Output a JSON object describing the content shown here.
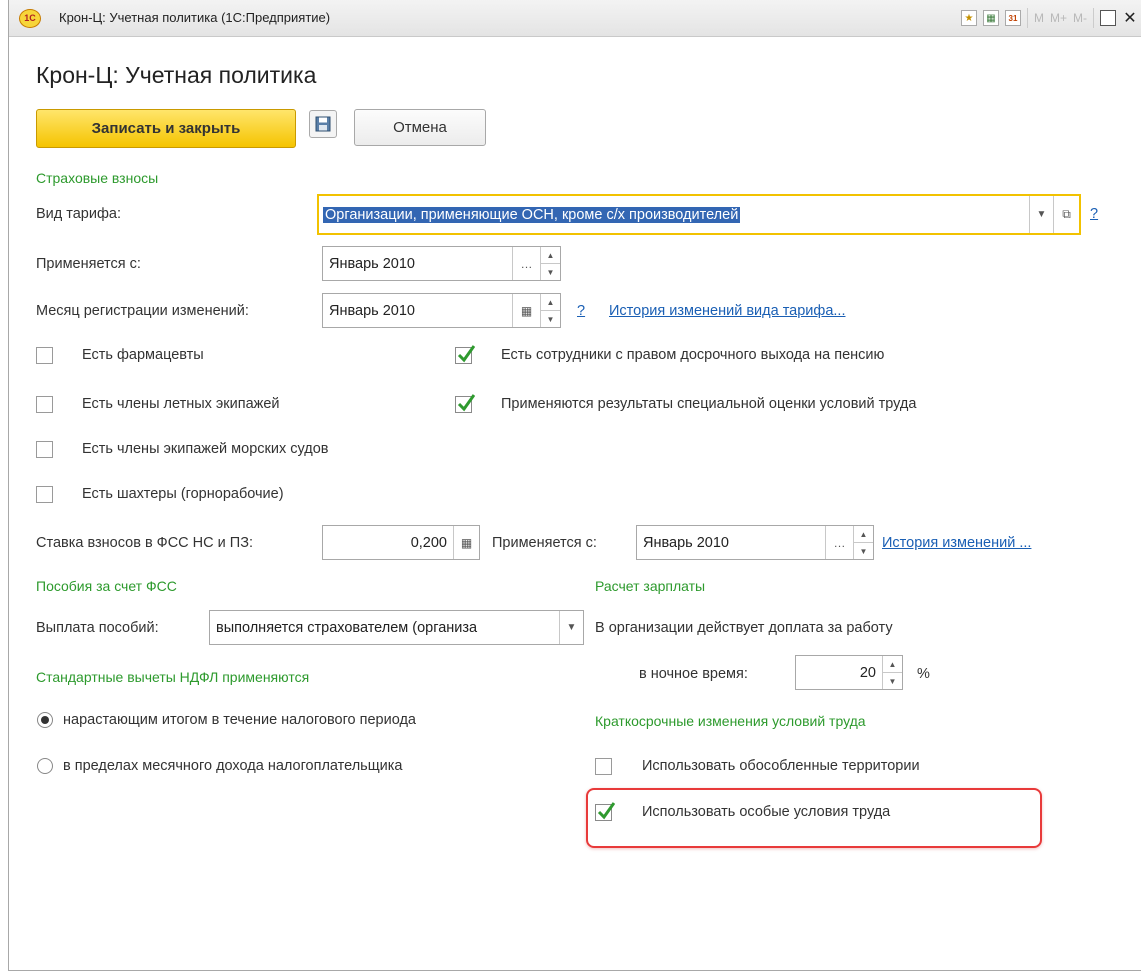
{
  "window": {
    "title": "Крон-Ц: Учетная политика  (1С:Предприятие)",
    "logo": "1С",
    "mem_buttons": [
      "M",
      "M+",
      "M-"
    ],
    "icons": [
      "favorites-icon",
      "calculator-icon",
      "calendar-icon",
      "maximize-icon",
      "close-icon"
    ]
  },
  "form": {
    "title": "Крон-Ц: Учетная политика",
    "buttons": {
      "save_close": "Записать и закрыть",
      "cancel": "Отмена"
    }
  },
  "insurance": {
    "section": "Страховые взносы",
    "tariff_label": "Вид тарифа:",
    "tariff_value": "Организации, применяющие ОСН, кроме с/х производителей",
    "applies_from_label": "Применяется с:",
    "applies_from_value": "Январь 2010",
    "reg_month_label": "Месяц регистрации изменений:",
    "reg_month_value": "Январь 2010",
    "help": "?",
    "history_link": "История изменений вида тарифа...",
    "checkboxes_left": [
      {
        "label": "Есть фармацевты",
        "checked": false
      },
      {
        "label": "Есть члены летных экипажей",
        "checked": false
      },
      {
        "label": "Есть члены экипажей морских судов",
        "checked": false
      },
      {
        "label": "Есть шахтеры (горнорабочие)",
        "checked": false
      }
    ],
    "checkboxes_right": [
      {
        "label": "Есть сотрудники с правом досрочного выхода на пенсию",
        "checked": true
      },
      {
        "label": "Применяются результаты специальной оценки условий труда",
        "checked": true
      }
    ],
    "fss_rate_label": "Ставка взносов в ФСС НС и ПЗ:",
    "fss_rate_value": "0,200",
    "fss_applies_label": "Применяется с:",
    "fss_applies_value": "Январь 2010",
    "fss_history_link": "История изменений ..."
  },
  "benefits": {
    "section": "Пособия за счет ФСС",
    "payment_label": "Выплата пособий:",
    "payment_value": "выполняется страхователем (организа"
  },
  "ndfl": {
    "section": "Стандартные вычеты НДФЛ применяются",
    "options": [
      {
        "label": "нарастающим итогом в течение налогового периода",
        "selected": true
      },
      {
        "label": "в пределах месячного дохода налогоплательщика",
        "selected": false
      }
    ]
  },
  "payroll": {
    "section": "Расчет зарплаты",
    "night_text": "В организации действует доплата за работу",
    "night_label": "в ночное время:",
    "night_value": "20",
    "percent": "%"
  },
  "short_term": {
    "section": "Краткосрочные изменения условий труда",
    "options": [
      {
        "label": "Использовать обособленные территории",
        "checked": false
      },
      {
        "label": "Использовать особые условия труда",
        "checked": true
      }
    ]
  }
}
